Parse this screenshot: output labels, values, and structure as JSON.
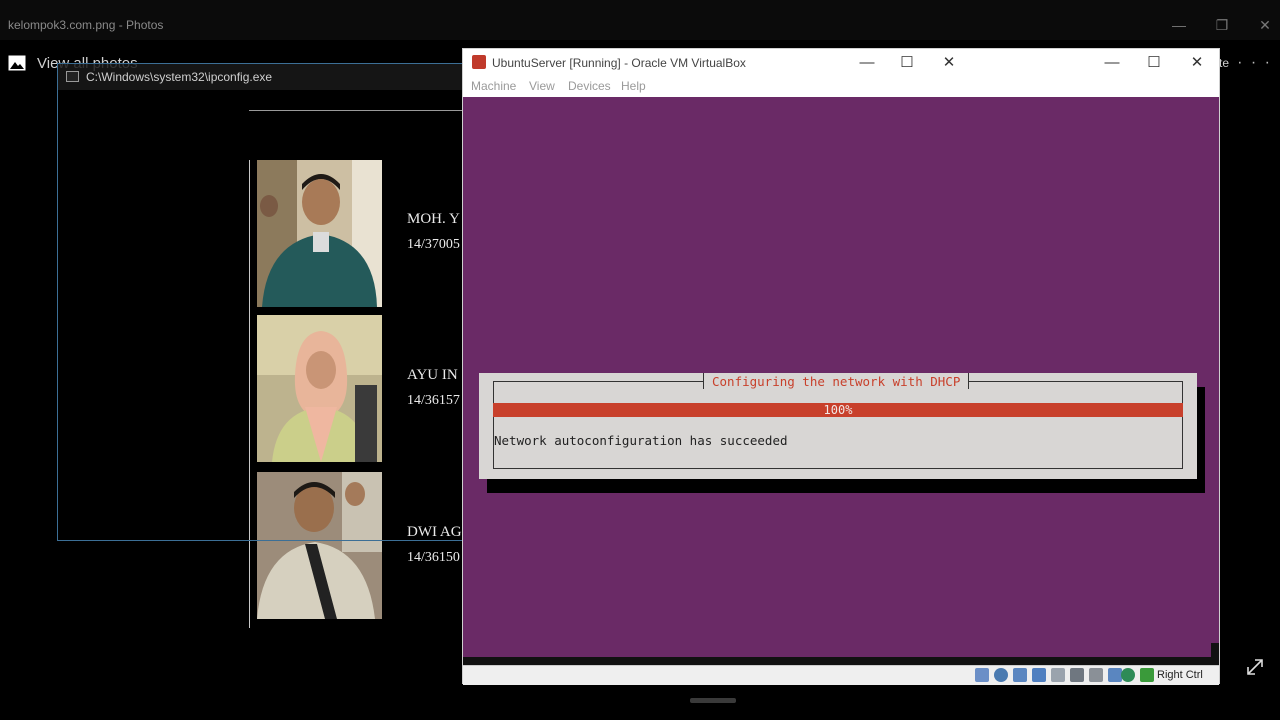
{
  "photos": {
    "window_title": "kelompok3.com.png - Photos",
    "view_all_label": "View all photos",
    "partial_right_text": "te",
    "more_label": "· · ·"
  },
  "slide": {
    "members": [
      {
        "name": "MOH. Y",
        "nim": "14/37005"
      },
      {
        "name": "AYU IN",
        "nim": "14/36157"
      },
      {
        "name": "DWI AG",
        "nim": "14/36150"
      }
    ]
  },
  "cmd": {
    "title": "C:\\Windows\\system32\\ipconfig.exe"
  },
  "vbox": {
    "title": "UbuntuServer [Running] - Oracle VM VirtualBox",
    "menu": [
      "Machine",
      "View",
      "Devices",
      "Help"
    ],
    "host_key_label": "Right Ctrl"
  },
  "installer": {
    "dialog_title": "Configuring the network with DHCP",
    "progress_percent": 100,
    "progress_label": "100%",
    "message": "Network autoconfiguration has succeeded"
  }
}
